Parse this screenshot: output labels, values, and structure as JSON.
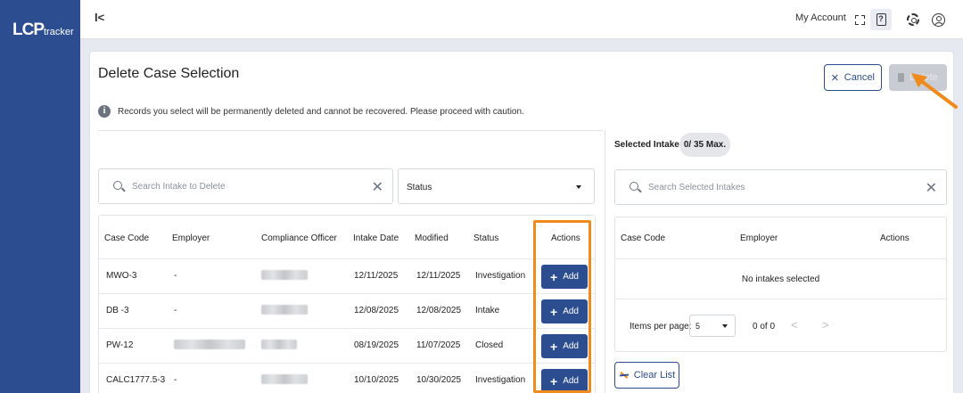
{
  "app": {
    "logo_main": "LCP",
    "logo_sub": "tracker"
  },
  "topbar": {
    "collapse_label": "I<",
    "my_account": "My Account",
    "icons": [
      "expand-icon",
      "help-icon",
      "gear-icon",
      "user-icon"
    ]
  },
  "page": {
    "title": "Delete Case Selection",
    "cancel_label": "Cancel",
    "delete_label": "Delete",
    "info_text": "Records you select will be permanently deleted and cannot be recovered. Please proceed with caution."
  },
  "left": {
    "search_placeholder": "Search Intake to Delete",
    "status_value": "Status",
    "columns": [
      "Case Code",
      "Employer",
      "Compliance Officer",
      "Intake Date",
      "Modified",
      "Status",
      "Actions"
    ],
    "rows": [
      {
        "case_code": "MWO-3",
        "employer": "-",
        "intake_date": "12/11/2025",
        "modified": "12/11/2025",
        "status": "Investigation",
        "action": "Add"
      },
      {
        "case_code": "DB -3",
        "employer": "-",
        "intake_date": "12/08/2025",
        "modified": "12/08/2025",
        "status": "Intake",
        "action": "Add"
      },
      {
        "case_code": "PW-12",
        "employer": "",
        "intake_date": "08/19/2025",
        "modified": "11/07/2025",
        "status": "Closed",
        "action": "Add"
      },
      {
        "case_code": "CALC1777.5-3",
        "employer": "-",
        "intake_date": "10/10/2025",
        "modified": "10/30/2025",
        "status": "Investigation",
        "action": "Add"
      }
    ]
  },
  "right": {
    "selected_label": "Selected Intakes:",
    "selected_count": "0/ 35 Max.",
    "search_placeholder": "Search Selected Intakes",
    "columns": [
      "Case Code",
      "Employer",
      "Actions"
    ],
    "empty_text": "No intakes selected",
    "items_per_page_label": "Items per page:",
    "items_per_page_value": "5",
    "range_text": "0 of 0",
    "prev": "<",
    "next": ">",
    "clear_label": "Clear List"
  },
  "colors": {
    "brand": "#2c4d8f",
    "highlight": "#f08a1c"
  }
}
